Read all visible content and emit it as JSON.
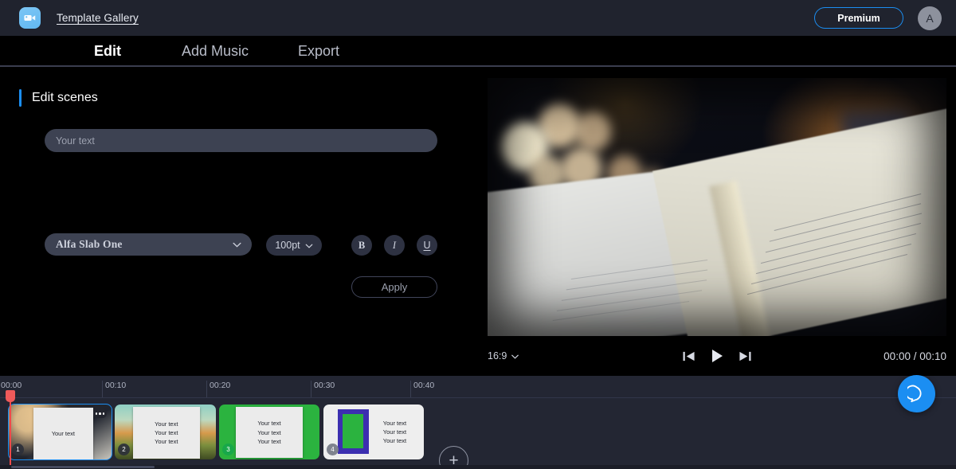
{
  "header": {
    "logo_icon": "video-camera-icon",
    "template_gallery_link": "Template Gallery",
    "premium_label": "Premium",
    "avatar_initial": "A",
    "accent_color": "#1b8ef2",
    "bg_color": "#20232e"
  },
  "tabs": [
    {
      "label": "Edit",
      "active": true
    },
    {
      "label": "Add Music",
      "active": false
    },
    {
      "label": "Export",
      "active": false
    }
  ],
  "edit_panel": {
    "section_title": "Edit scenes",
    "text_field": {
      "value": "",
      "placeholder": "Your text"
    },
    "font_select": {
      "value": "Alfa Slab One",
      "chevron_icon": "chevron-down-icon"
    },
    "size_select": {
      "value": "100pt",
      "chevron_icon": "chevron-down-icon"
    },
    "format_buttons": [
      {
        "label": "B",
        "name": "bold"
      },
      {
        "label": "I",
        "name": "italic"
      },
      {
        "label": "U",
        "name": "underline"
      }
    ],
    "apply_label": "Apply"
  },
  "preview": {
    "aspect_ratio": "16:9",
    "aspect_chevron_icon": "chevron-down-icon",
    "transport": {
      "prev_icon": "skip-previous-icon",
      "play_icon": "play-icon",
      "next_icon": "skip-next-icon"
    },
    "timecode_current": "00:00",
    "timecode_separator": "/",
    "timecode_total": "00:10",
    "timecode": "00:00 / 00:10"
  },
  "timeline": {
    "ruler_labels": [
      "00:00",
      "00:10",
      "00:20",
      "00:30",
      "00:40"
    ],
    "playhead_position": "00:00",
    "add_scene_label": "+",
    "clips": [
      {
        "number": "1",
        "selected": true,
        "menu_icon": "more-options-icon",
        "lines": [
          "Your text"
        ],
        "background": "bokeh-dark"
      },
      {
        "number": "2",
        "selected": false,
        "lines": [
          "Your text",
          "Your text",
          "Your text"
        ],
        "background": "sunset-field"
      },
      {
        "number": "3",
        "selected": false,
        "lines": [
          "Your text",
          "Your text",
          "Your text"
        ],
        "background": "green"
      },
      {
        "number": "4",
        "selected": false,
        "lines": [
          "Your text",
          "Your text",
          "Your text"
        ],
        "background": "white-purple-frame"
      }
    ]
  },
  "help": {
    "icon": "chat-bubble-icon",
    "color": "#1b8ef2"
  }
}
